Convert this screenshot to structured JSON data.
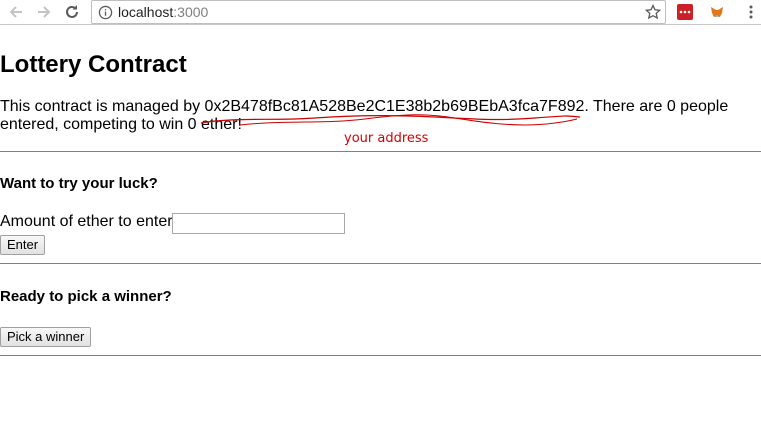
{
  "browser": {
    "url_host": "localhost",
    "url_port": ":3000"
  },
  "page": {
    "title": "Lottery Contract",
    "description_prefix": "This contract is managed by ",
    "manager_address": "0x2B478fBc81A528Be2C1E38b2b69BEbA3fca7F892",
    "description_suffix": ". There are 0 people entered, competing to win 0 ether!",
    "annotation": "your address",
    "enter_section": {
      "heading": "Want to try your luck?",
      "amount_label": "Amount of ether to enter",
      "amount_value": "",
      "button_label": "Enter"
    },
    "winner_section": {
      "heading": "Ready to pick a winner?",
      "button_label": "Pick a winner"
    }
  },
  "colors": {
    "annotation": "#d40000"
  }
}
